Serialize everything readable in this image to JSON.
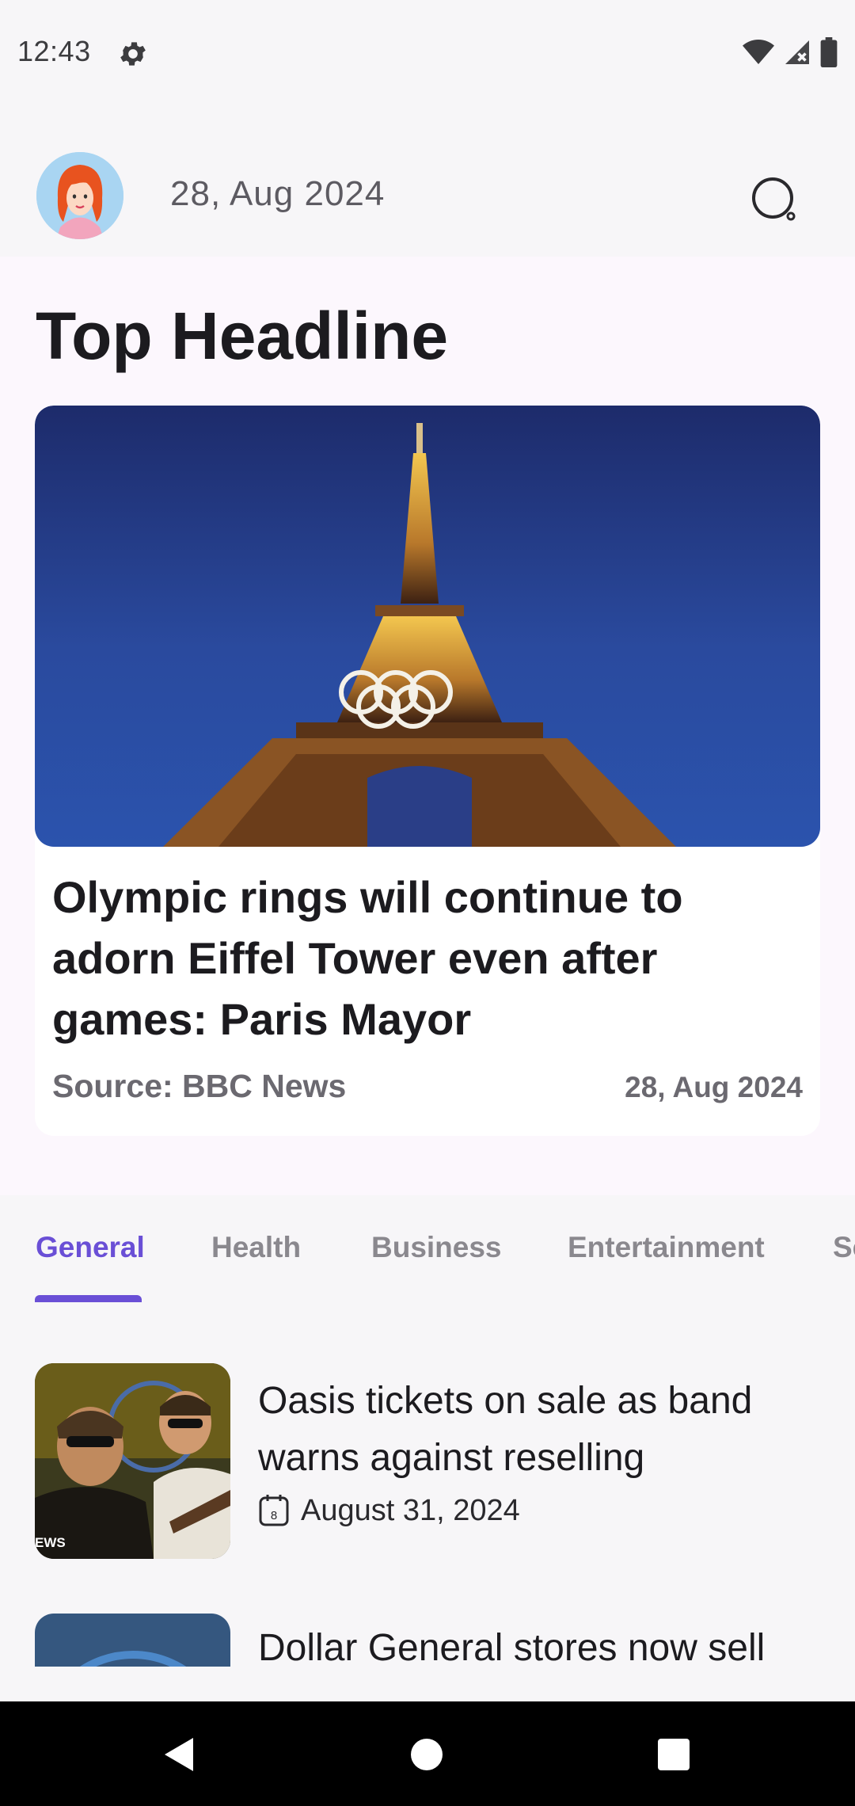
{
  "status_bar": {
    "time": "12:43",
    "icons": [
      "gear-icon",
      "wifi-icon",
      "signal-icon",
      "battery-icon"
    ]
  },
  "header": {
    "date": "28, Aug 2024",
    "avatar_icon": "avatar",
    "search_icon": "search-icon"
  },
  "top_headline": {
    "section_title": "Top Headline",
    "card": {
      "title": "Olympic rings will continue to adorn Eiffel Tower even after games: Paris Mayor",
      "source": "Source: BBC News",
      "date": "28, Aug 2024"
    }
  },
  "tabs": {
    "items": [
      "General",
      "Health",
      "Business",
      "Entertainment",
      "Sc"
    ],
    "active": "General"
  },
  "articles": [
    {
      "title": "Oasis tickets on sale as band warns against reselling",
      "date": "August 31, 2024",
      "thumb_overlay": "EWS",
      "calendar_day": "8"
    },
    {
      "title": "Dollar General stores now sell"
    }
  ],
  "nav_bar": {
    "icons": [
      "back-icon",
      "home-icon",
      "recents-icon"
    ]
  },
  "colors": {
    "accent": "#6a4fd6",
    "content_bg": "#fcf7fd",
    "page_bg": "#f7f6f8",
    "nav_bg": "#000000"
  }
}
